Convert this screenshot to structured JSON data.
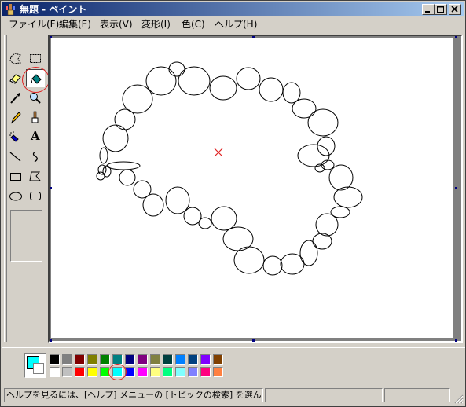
{
  "window": {
    "title": "無題 - ペイント"
  },
  "menu": [
    "ファイル(F)",
    "編集(E)",
    "表示(V)",
    "変形(I)",
    "色(C)",
    "ヘルプ(H)"
  ],
  "tools": [
    {
      "name": "free-form-select-icon"
    },
    {
      "name": "select-icon"
    },
    {
      "name": "eraser-icon"
    },
    {
      "name": "fill-with-color-icon",
      "selected": true
    },
    {
      "name": "pick-color-icon"
    },
    {
      "name": "magnifier-icon"
    },
    {
      "name": "pencil-icon"
    },
    {
      "name": "brush-icon"
    },
    {
      "name": "airbrush-icon"
    },
    {
      "name": "text-icon",
      "glyph": "A"
    },
    {
      "name": "line-icon"
    },
    {
      "name": "curve-icon"
    },
    {
      "name": "rectangle-icon"
    },
    {
      "name": "polygon-icon"
    },
    {
      "name": "ellipse-icon"
    },
    {
      "name": "rounded-rectangle-icon"
    }
  ],
  "colors": {
    "foreground": "#00ffff",
    "background": "#ffffff",
    "palette_top": [
      "#000000",
      "#808080",
      "#800000",
      "#808000",
      "#008000",
      "#008080",
      "#000080",
      "#800080",
      "#808040",
      "#004040",
      "#0080ff",
      "#004080",
      "#8000ff",
      "#804000"
    ],
    "palette_bottom": [
      "#ffffff",
      "#c0c0c0",
      "#ff0000",
      "#ffff00",
      "#00ff00",
      "#00ffff",
      "#0000ff",
      "#ff00ff",
      "#ffff80",
      "#00ff80",
      "#80ffff",
      "#8080ff",
      "#ff0080",
      "#ff8040"
    ]
  },
  "status": {
    "help_text": "ヘルプを見るには、[ヘルプ] メニューの [トピックの検索] を選んでください。"
  }
}
